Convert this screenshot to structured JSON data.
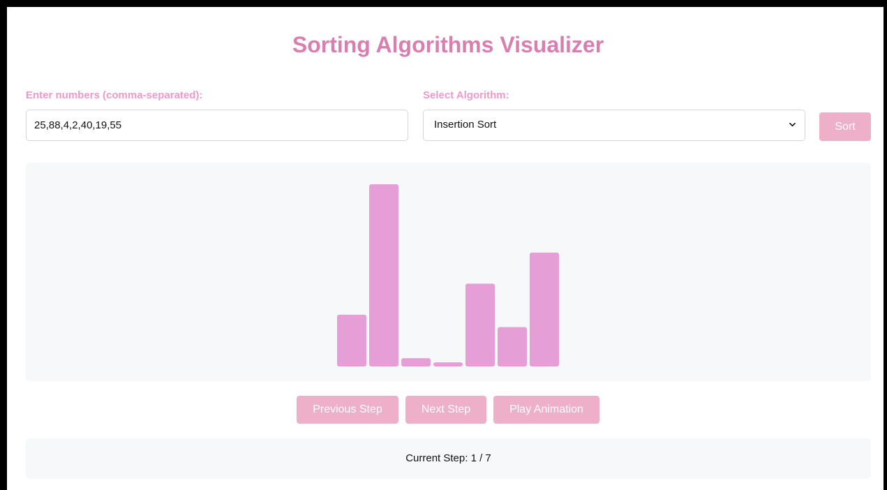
{
  "page": {
    "title": "Sorting Algorithms Visualizer"
  },
  "inputs": {
    "numbers_label": "Enter numbers (comma-separated):",
    "numbers_value": "25,88,4,2,40,19,55",
    "algorithm_label": "Select Algorithm:",
    "algorithm_selected": "Insertion Sort",
    "sort_label": "Sort"
  },
  "icons": {
    "select_arrow": "chevron-down-icon"
  },
  "controls": {
    "prev_label": "Previous Step",
    "next_label": "Next Step",
    "play_label": "Play Animation"
  },
  "status": {
    "step_text": "Current Step: 1 / 7"
  },
  "colors": {
    "accent": "#d97fb0",
    "label": "#ee99cc",
    "button": "#eeb0c8",
    "bar": "#e59fd6",
    "panel": "#f7f8fa"
  },
  "chart_data": {
    "type": "bar",
    "values": [
      25,
      88,
      4,
      2,
      40,
      19,
      55
    ],
    "ylim": [
      0,
      88
    ]
  }
}
